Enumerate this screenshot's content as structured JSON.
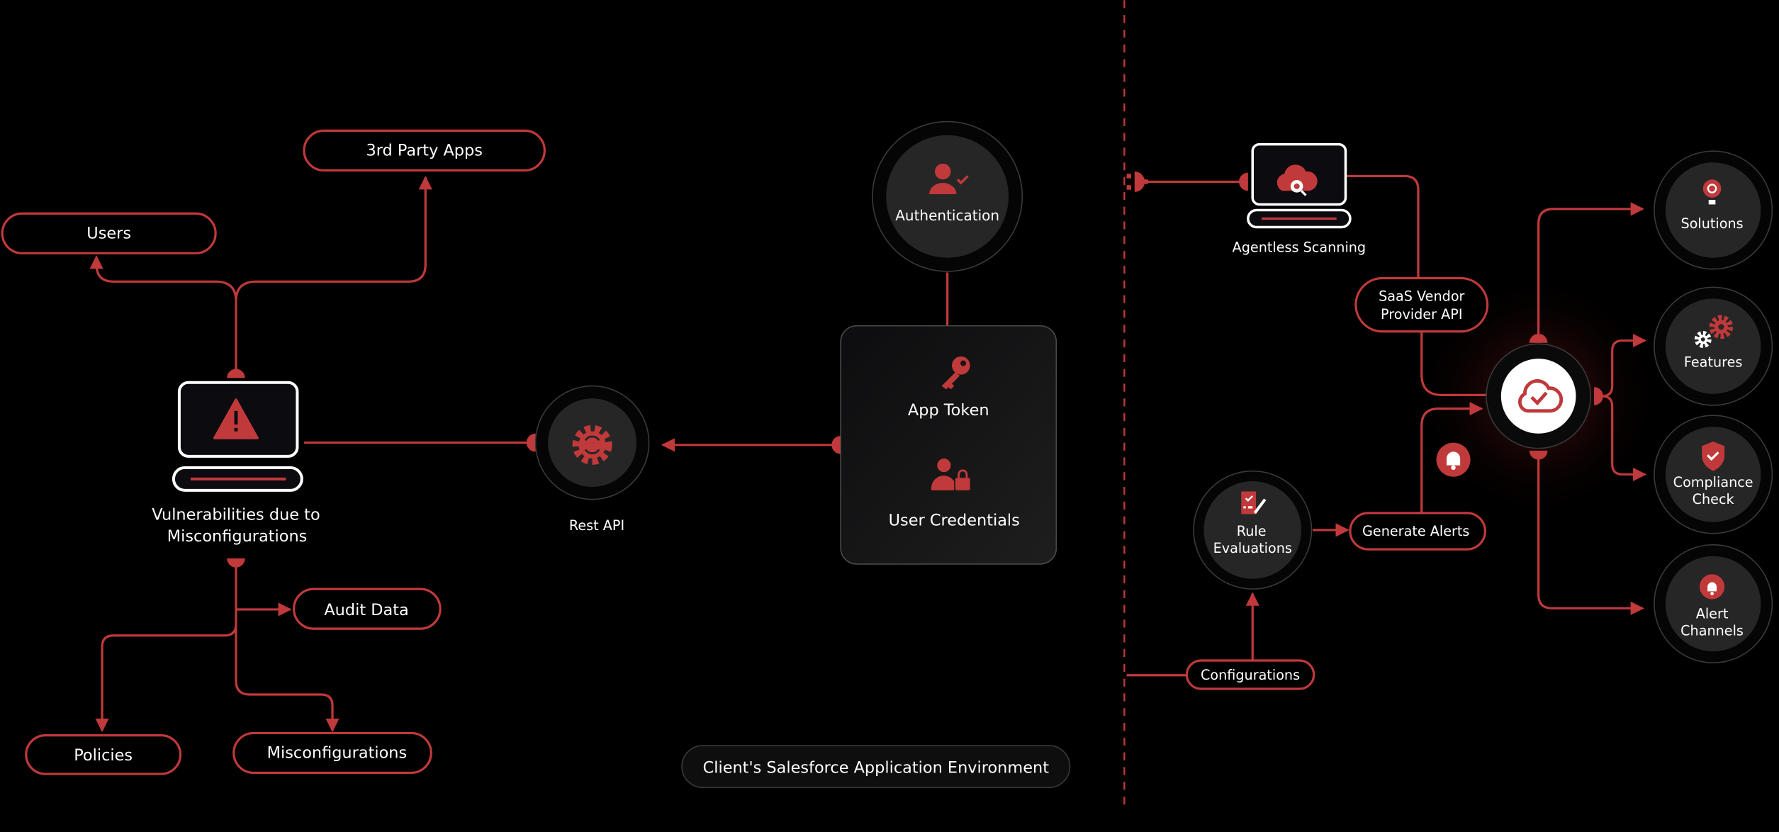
{
  "colors": {
    "accent": "#c0393b",
    "background": "#000000",
    "node_fill": "#262626"
  },
  "left": {
    "users": "Users",
    "third_party": "3rd Party Apps",
    "vuln_line1": "Vulnerabilities due to",
    "vuln_line2": "Misconfigurations",
    "audit": "Audit Data",
    "policies": "Policies",
    "misconfig": "Misconfigurations",
    "rest_api": "Rest API",
    "authentication": "Authentication",
    "app_token": "App Token",
    "user_credentials": "User Credentials",
    "environment": "Client's Salesforce Application Environment"
  },
  "right": {
    "agentless": "Agentless Scanning",
    "saas_line1": "SaaS Vendor",
    "saas_line2": "Provider API",
    "rule_line1": "Rule",
    "rule_line2": "Evaluations",
    "generate_alerts": "Generate Alerts",
    "configurations": "Configurations",
    "outputs": [
      {
        "line1": "Solutions",
        "line2": ""
      },
      {
        "line1": "Features",
        "line2": ""
      },
      {
        "line1": "Compliance",
        "line2": "Check"
      },
      {
        "line1": "Alert",
        "line2": "Channels"
      }
    ]
  },
  "icons": [
    "warning-icon",
    "gear-sync-icon",
    "user-check-icon",
    "key-icon",
    "user-lock-icon",
    "cloud-search-icon",
    "plug-icon",
    "cloud-check-icon",
    "bell-icon",
    "checklist-icon",
    "lightbulb-gear-icon",
    "gears-icon",
    "shield-check-icon"
  ]
}
